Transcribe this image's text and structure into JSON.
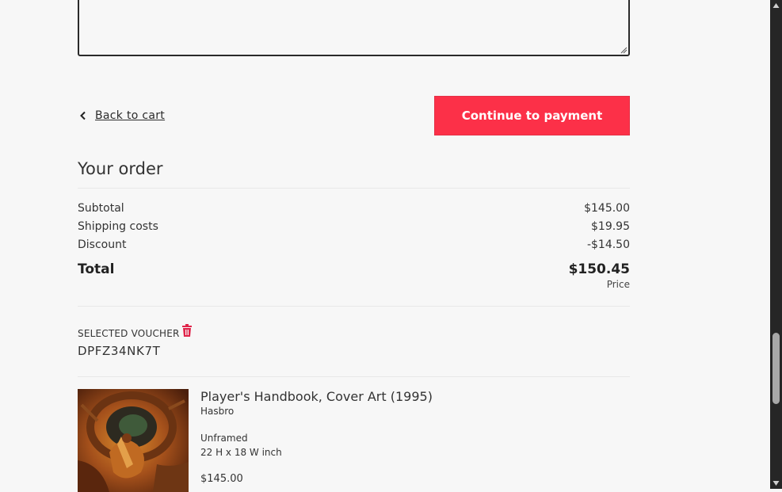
{
  "checkout": {
    "back_label": "Back to cart",
    "continue_label": "Continue to payment"
  },
  "order": {
    "title": "Your order",
    "subtotal_label": "Subtotal",
    "subtotal_value": "$145.00",
    "shipping_label": "Shipping costs",
    "shipping_value": "$19.95",
    "discount_label": "Discount",
    "discount_value": "-$14.50",
    "total_label": "Total",
    "total_value": "$150.45",
    "price_note": "Price"
  },
  "voucher": {
    "label": "SELECTED VOUCHER",
    "code": "DPFZ34NK7T"
  },
  "product": {
    "title": "Player's Handbook, Cover Art (1995)",
    "brand": "Hasbro",
    "frame": "Unframed",
    "size": "22 H x 18 W inch",
    "price": "$145.00"
  },
  "colors": {
    "accent": "#fc3048",
    "background": "#f7f7f7",
    "text": "#2b2b2b",
    "trash_icon": "#e0244a"
  }
}
